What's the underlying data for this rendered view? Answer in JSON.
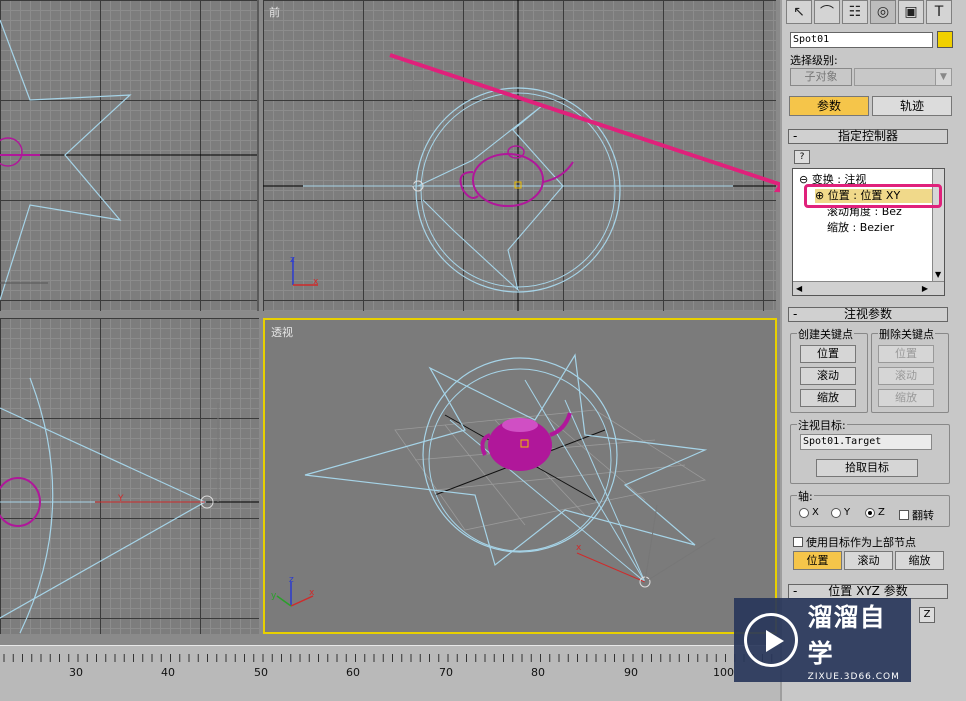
{
  "viewports": {
    "front_label": "前",
    "perspective_label": "透视",
    "axis_z": "z",
    "axis_x": "x",
    "axis_y": "y",
    "axis_z_upper": "Z",
    "axis_y_upper": "Y"
  },
  "timeline": {
    "ticks": [
      "30",
      "40",
      "50",
      "60",
      "70",
      "80",
      "90",
      "100"
    ]
  },
  "panel": {
    "tabs": [
      "create-icon",
      "modify-icon",
      "hierarchy-icon",
      "motion-icon",
      "display-icon",
      "utilities-icon"
    ],
    "object_name": "Spot01",
    "object_color": "#f0d000",
    "selection_level_label": "选择级别:",
    "subobject_label": "子对象",
    "params_label": "参数",
    "track_label": "轨迹",
    "assign_controller_title": "指定控制器",
    "help_icon": "?",
    "tree": {
      "root": "变换 : 注视",
      "position": "位置 : 位置 XY",
      "roll": "滚动角度 : Bez",
      "scale": "缩放 : Bezier"
    },
    "lookat_title": "注视参数",
    "create_key_label": "创建关键点",
    "delete_key_label": "删除关键点",
    "create_buttons": [
      "位置",
      "滚动",
      "缩放"
    ],
    "delete_buttons": [
      "位置",
      "滚动",
      "缩放"
    ],
    "target_label": "注视目标:",
    "target_value": "Spot01.Target",
    "pick_target": "拾取目标",
    "axis_label": "轴:",
    "axis_options": [
      "X",
      "Y",
      "Z"
    ],
    "axis_selected": "Z",
    "flip_label": "翻转",
    "use_parent_label": "使用目标作为上部节点",
    "bottom_tabs": [
      "位置",
      "滚动",
      "缩放"
    ],
    "pos_xyz_title": "位置 XYZ 参数",
    "z_button": "Z"
  },
  "watermark": {
    "main": "溜溜自学",
    "sub": "ZIXUE.3D66.COM"
  },
  "colors": {
    "accent_yellow": "#f5c54a",
    "highlight_pink": "#e0217b",
    "teapot_magenta": "#b0179a",
    "light_cyan": "#a6d4e8"
  }
}
